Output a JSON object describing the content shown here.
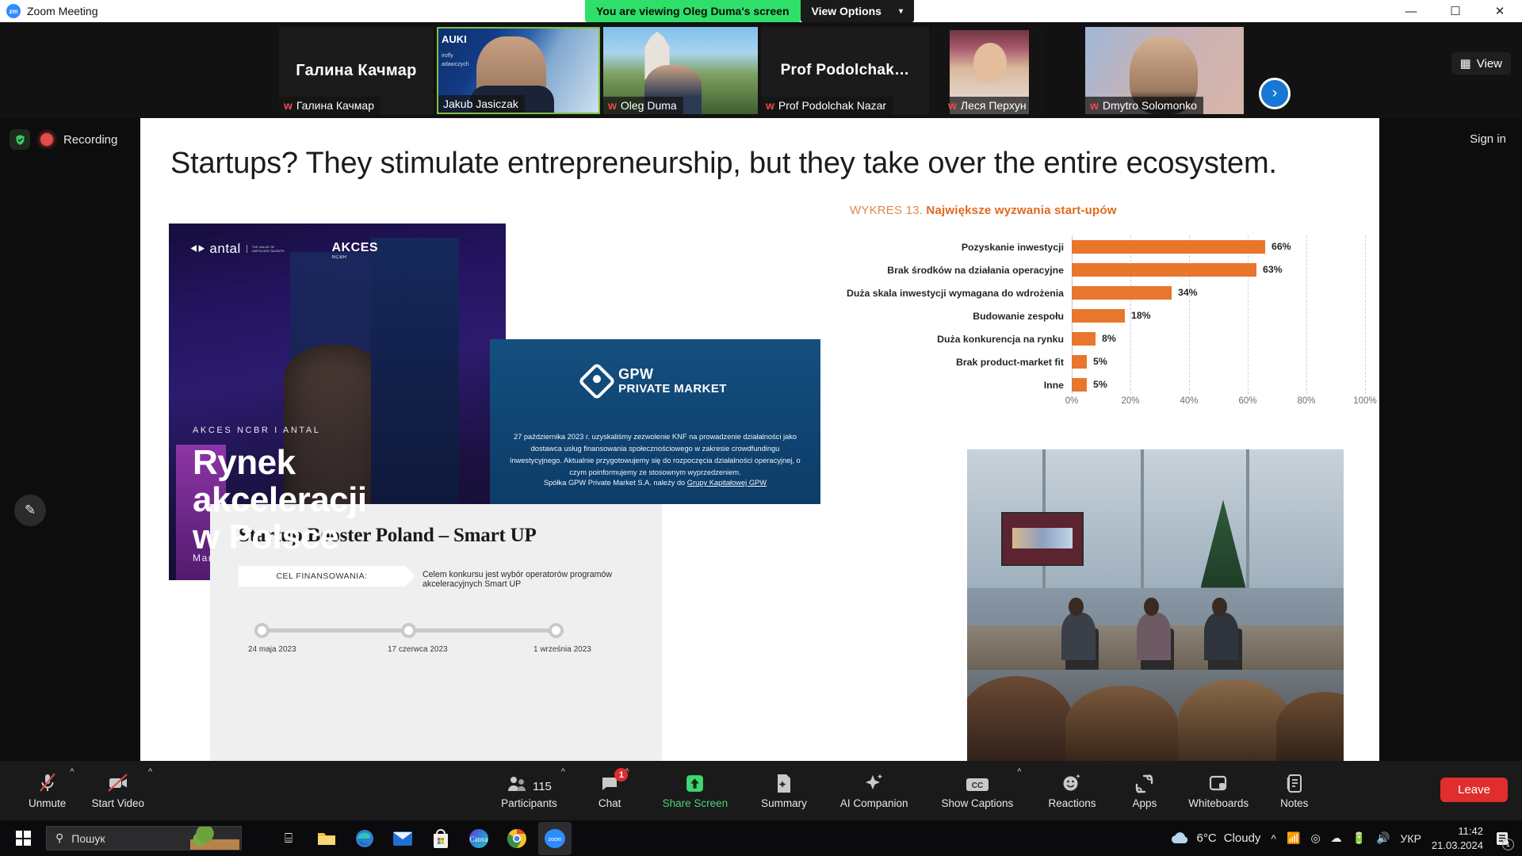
{
  "window": {
    "app_title": "Zoom Meeting",
    "logo_text": "zm",
    "minimize": "–",
    "maximize": "☐",
    "close": "✕"
  },
  "sharing": {
    "banner": "You are viewing Oleg Duma's screen",
    "view_options": "View Options",
    "caret": "⌄"
  },
  "filmstrip": {
    "view_label": "View",
    "next_arrow": "›",
    "tiles": [
      {
        "name": "Галина Качмар",
        "big_name": "Галина Качмар",
        "muted": true,
        "video": false,
        "active": false
      },
      {
        "name": "Jakub Jasiczak",
        "big_name": "",
        "muted": false,
        "video": true,
        "active": true
      },
      {
        "name": "Oleg Duma",
        "big_name": "",
        "muted": true,
        "video": true,
        "active": false
      },
      {
        "name": "Prof Podolchak Nazar",
        "big_name": "Prof  Podolchak…",
        "muted": true,
        "video": false,
        "active": false
      },
      {
        "name": "Леся Перхун",
        "big_name": "",
        "muted": true,
        "video": true,
        "active": false
      },
      {
        "name": "Dmytro Solomonko",
        "big_name": "",
        "muted": true,
        "video": true,
        "active": false
      }
    ]
  },
  "stage": {
    "recording_label": "Recording",
    "sign_in": "Sign in",
    "pen_icon": "✎"
  },
  "slide": {
    "title": "Startups? They stimulate entrepreneurship, but they take over the entire ecosystem.",
    "cover": {
      "logo_antal_mark": "⯇⯈",
      "logo_antal_word": "antal",
      "logo_antal_tagline": "THE VALUE OF\nUNFOLDED TALENTS",
      "logo_akces_line1": "AKCES",
      "logo_akces_line2": "NCBR",
      "kicker": "AKCES NCBR I ANTAL",
      "headline": "Rynek\nakceleracji\nw Polsce",
      "date": "Marzec 2024"
    },
    "gpw": {
      "logo_line1": "GPW",
      "logo_line2": "PRIVATE MARKET",
      "body": "27 października 2023 r. uzyskaliśmy zezwolenie KNF na prowadzenie działalności jako dostawca usług finansowania społecznościowego w zakresie crowdfundingu inwestycyjnego. Aktualnie przygotowujemy się do rozpoczęcia działalności operacyjnej, o czym poinformujemy ze stosownym wyprzedzeniem.",
      "footer_before": "Spółka GPW Private Market S.A. należy do ",
      "footer_link": "Grupy Kapitałowej GPW"
    },
    "booster": {
      "heading": "Startup Booster Poland – Smart UP",
      "chip_label": "CEL FINANSOWANIA:",
      "chip_text": "Celem konkursu jest wybór operatorów programów akceleracyjnych Smart UP",
      "milestones": [
        "24 maja 2023",
        "17 czerwca 2023",
        "1 września 2023"
      ]
    }
  },
  "chart_data": {
    "type": "bar",
    "orientation": "horizontal",
    "title_prefix": "WYKRES 13.",
    "title": "Największe wyzwania start-upów",
    "categories": [
      "Pozyskanie inwestycji",
      "Brak środków na działania operacyjne",
      "Duża skala inwestycji wymagana do wdrożenia",
      "Budowanie zespołu",
      "Duża konkurencja na rynku",
      "Brak product-market fit",
      "Inne"
    ],
    "values": [
      66,
      63,
      34,
      18,
      8,
      5,
      5
    ],
    "value_labels": [
      "66%",
      "63%",
      "34%",
      "18%",
      "8%",
      "5%",
      "5%"
    ],
    "xticks": [
      0,
      20,
      40,
      60,
      80,
      100
    ],
    "xtick_labels": [
      "0%",
      "20%",
      "40%",
      "60%",
      "80%",
      "100%"
    ],
    "xlim": [
      0,
      100
    ],
    "xlabel": "",
    "ylabel": "",
    "grid": true,
    "legend": false,
    "bar_color": "#e8762d",
    "title_color": "#e06a1e"
  },
  "toolbar": {
    "items": [
      {
        "label": "Unmute",
        "icon": "mic-off-icon",
        "caret": true,
        "green": false
      },
      {
        "label": "Start Video",
        "icon": "video-off-icon",
        "caret": true,
        "green": false
      },
      {
        "label": "Participants",
        "icon": "participants-icon",
        "caret": true,
        "green": false,
        "count": "115"
      },
      {
        "label": "Chat",
        "icon": "chat-icon",
        "caret": true,
        "green": false,
        "badge": "1"
      },
      {
        "label": "Share Screen",
        "icon": "share-screen-icon",
        "caret": false,
        "green": true
      },
      {
        "label": "Summary",
        "icon": "summary-icon",
        "caret": false,
        "green": false
      },
      {
        "label": "AI Companion",
        "icon": "ai-companion-icon",
        "caret": false,
        "green": false
      },
      {
        "label": "Show Captions",
        "icon": "closed-captions-icon",
        "caret": true,
        "green": false
      },
      {
        "label": "Reactions",
        "icon": "reactions-icon",
        "caret": false,
        "green": false
      },
      {
        "label": "Apps",
        "icon": "apps-icon",
        "caret": false,
        "green": false
      },
      {
        "label": "Whiteboards",
        "icon": "whiteboard-icon",
        "caret": false,
        "green": false
      },
      {
        "label": "Notes",
        "icon": "notes-icon",
        "caret": false,
        "green": false
      }
    ],
    "leave": "Leave"
  },
  "taskbar": {
    "search_placeholder": "Пошук",
    "weather_temp": "6°C",
    "weather_desc": "Cloudy",
    "language": "УКР",
    "time": "11:42",
    "date": "21.03.2024",
    "notification_count": "1",
    "apps": [
      {
        "name": "task-view-icon",
        "glyph": "⌸"
      },
      {
        "name": "file-explorer-icon",
        "glyph": "📁"
      },
      {
        "name": "microsoft-edge-icon",
        "glyph": "e"
      },
      {
        "name": "mail-icon",
        "glyph": "✉"
      },
      {
        "name": "microsoft-store-icon",
        "glyph": "⊞"
      },
      {
        "name": "canva-icon",
        "glyph": "Canva"
      },
      {
        "name": "google-chrome-icon",
        "glyph": "●"
      },
      {
        "name": "zoom-taskbar-icon",
        "glyph": "zoom"
      }
    ]
  }
}
